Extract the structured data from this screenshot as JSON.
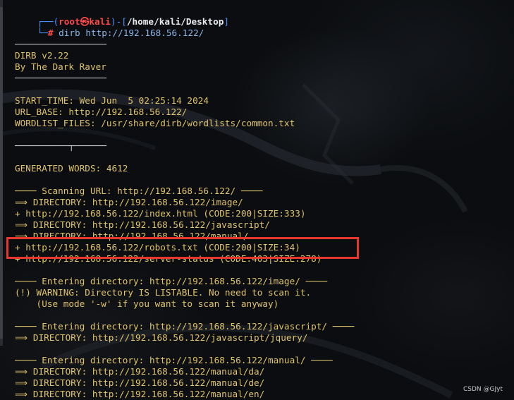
{
  "prompt": {
    "box_top": "┌──(",
    "user": "root",
    "at": "㉿",
    "host": "kali",
    "sep": ")-[",
    "cwd": "/home/kali/Desktop",
    "close": "]",
    "box_bottom": "└─",
    "hash": "#",
    "command": " dirb http://192.168.56.122/"
  },
  "lines": {
    "rule1": "─────────────────",
    "banner_version": "DIRB v2.22",
    "banner_author": "By The Dark Raver",
    "rule2": "─────────────────",
    "start_time": "START_TIME: Wed Jun  5 02:25:14 2024",
    "url_base": "URL_BASE: http://192.168.56.122/",
    "wordlist": "WORDLIST_FILES: /usr/share/dirb/wordlists/common.txt",
    "rule3": "──────────┬──────",
    "generated": "GENERATED WORDS: 4612",
    "scan_header": "──── Scanning URL: http://192.168.56.122/ ────",
    "dir_image": "⟹ DIRECTORY: http://192.168.56.122/image/",
    "file_index": "+ http://192.168.56.122/index.html (CODE:200|SIZE:333)",
    "dir_javascript": "⟹ DIRECTORY: http://192.168.56.122/javascript/",
    "dir_manual": "⟹ DIRECTORY: http://192.168.56.122/manual/",
    "file_robots": "+ http://192.168.56.122/robots.txt (CODE:200|SIZE:34)",
    "file_server_status": "+ http://192.168.56.122/server-status (CODE:403|SIZE:278)",
    "enter_image": "──── Entering directory: http://192.168.56.122/image/ ────",
    "warning": "(!) WARNING: Directory IS LISTABLE. No need to scan it.",
    "warning_hint": "    (Use mode '-w' if you want to scan it anyway)",
    "enter_javascript": "──── Entering directory: http://192.168.56.122/javascript/ ────",
    "dir_jquery": "⟹ DIRECTORY: http://192.168.56.122/javascript/jquery/",
    "enter_manual": "──── Entering directory: http://192.168.56.122/manual/ ────",
    "dir_da": "⟹ DIRECTORY: http://192.168.56.122/manual/da/",
    "dir_de": "⟹ DIRECTORY: http://192.168.56.122/manual/de/",
    "dir_en": "⟹ DIRECTORY: http://192.168.56.122/manual/en/"
  },
  "watermark": "CSDN @GJyt",
  "colors": {
    "highlight": "#e8372c",
    "prompt_user": "#ff4a4a",
    "prompt_path": "#4d91ff"
  }
}
